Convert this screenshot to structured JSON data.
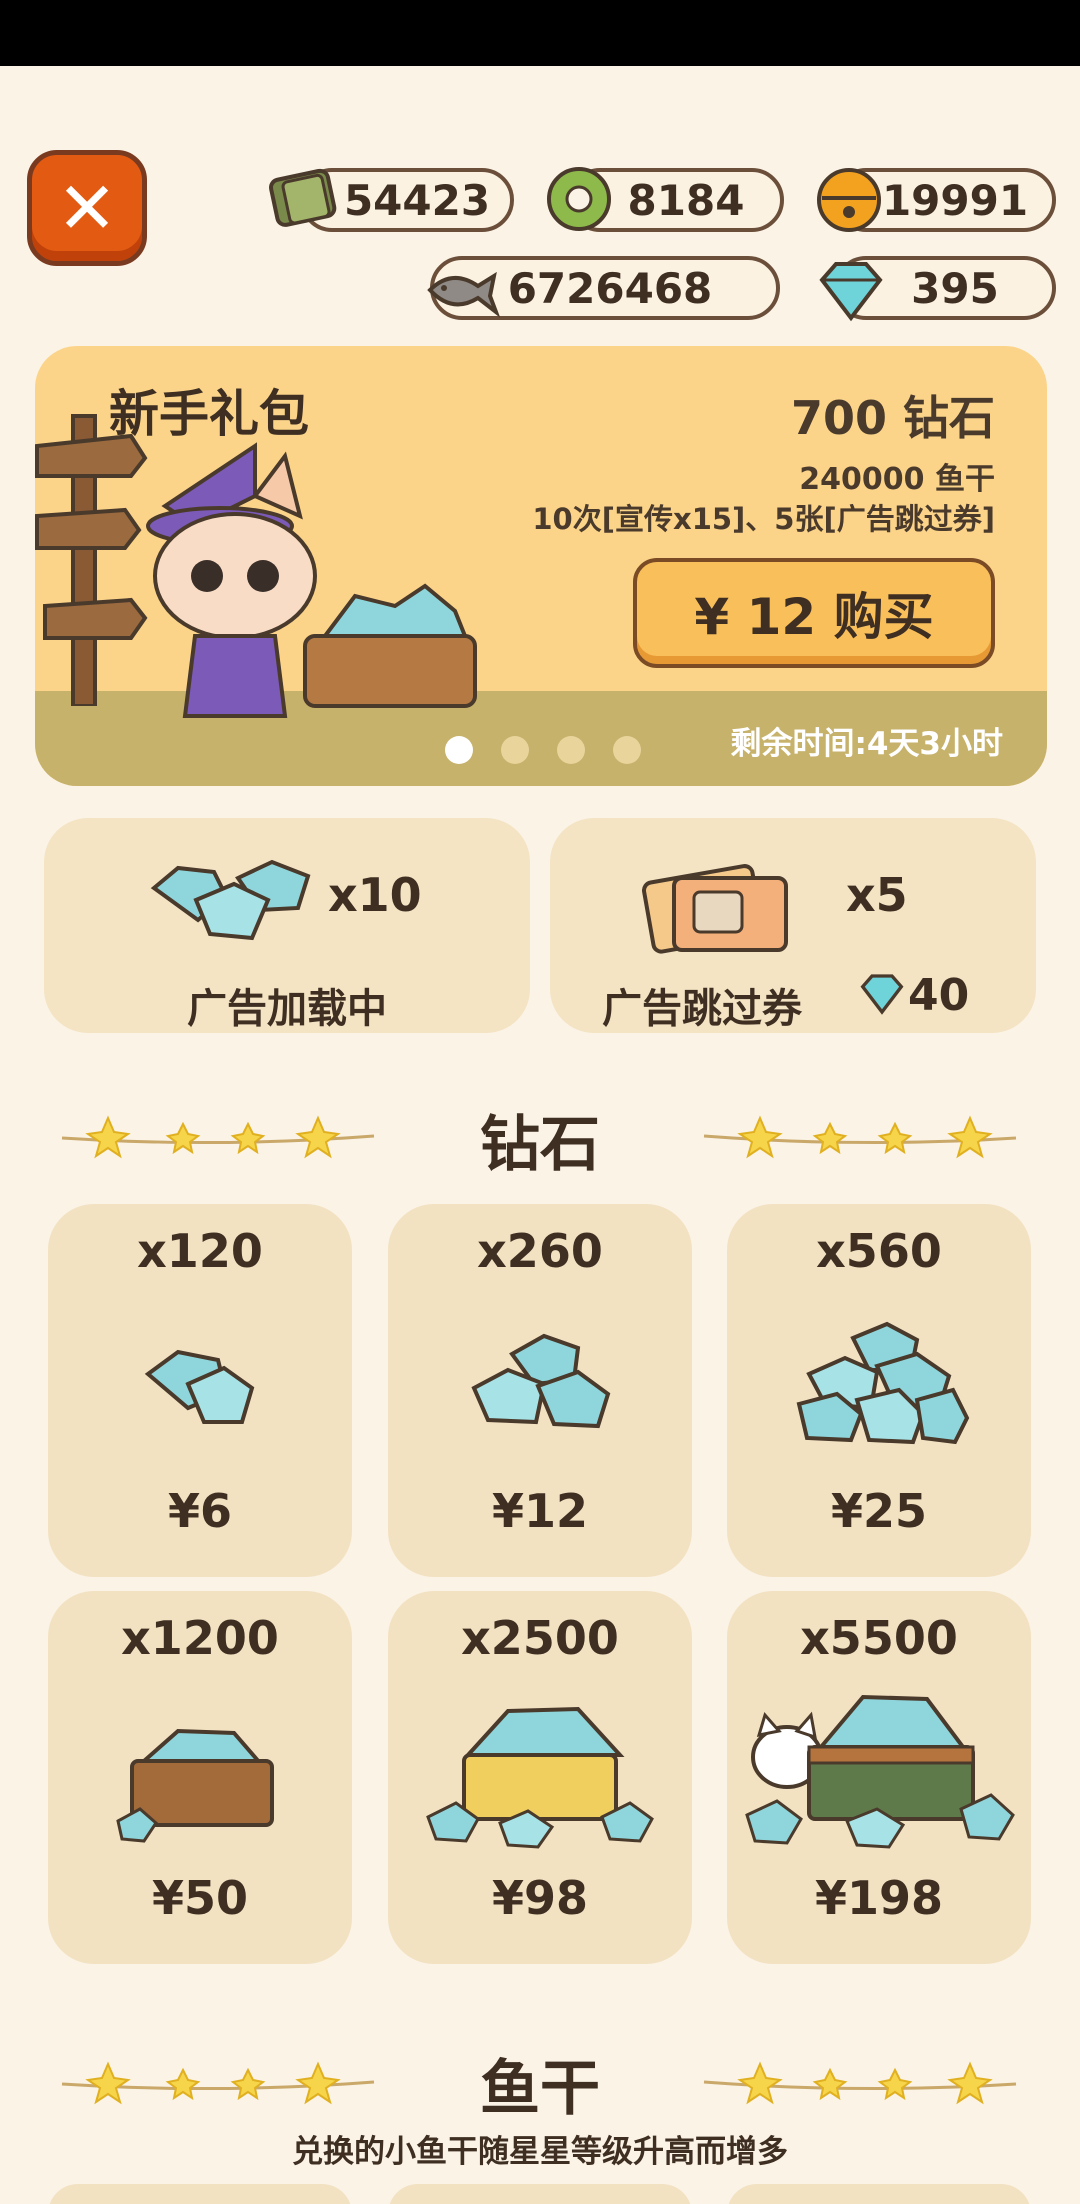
{
  "header": {
    "close_label": "✕"
  },
  "currencies": {
    "tickets": "54423",
    "coins": "8184",
    "bells": "19991",
    "fish": "6726468",
    "diamonds": "395"
  },
  "banner": {
    "title": "新手礼包",
    "amount": "700 钻石",
    "line2": "240000 鱼干",
    "line3": "10次[宣传x15]、5张[广告跳过券]",
    "buy_label": "¥ 12 购买",
    "remaining": "剩余时间:4天3小时",
    "pages": 4,
    "active_page": 1
  },
  "ads": {
    "diamond_ad": {
      "count": "x10",
      "label": "广告加载中"
    },
    "skip_ticket": {
      "count": "x5",
      "label": "广告跳过券",
      "price": "40"
    }
  },
  "diamond_section": {
    "title": "钻石",
    "packs": [
      {
        "qty": "x120",
        "price": "¥6"
      },
      {
        "qty": "x260",
        "price": "¥12"
      },
      {
        "qty": "x560",
        "price": "¥25"
      },
      {
        "qty": "x1200",
        "price": "¥50"
      },
      {
        "qty": "x2500",
        "price": "¥98"
      },
      {
        "qty": "x5500",
        "price": "¥198"
      }
    ]
  },
  "fish_section": {
    "title": "鱼干",
    "subtitle": "兑换的小鱼干随星星等级升高而增多"
  }
}
